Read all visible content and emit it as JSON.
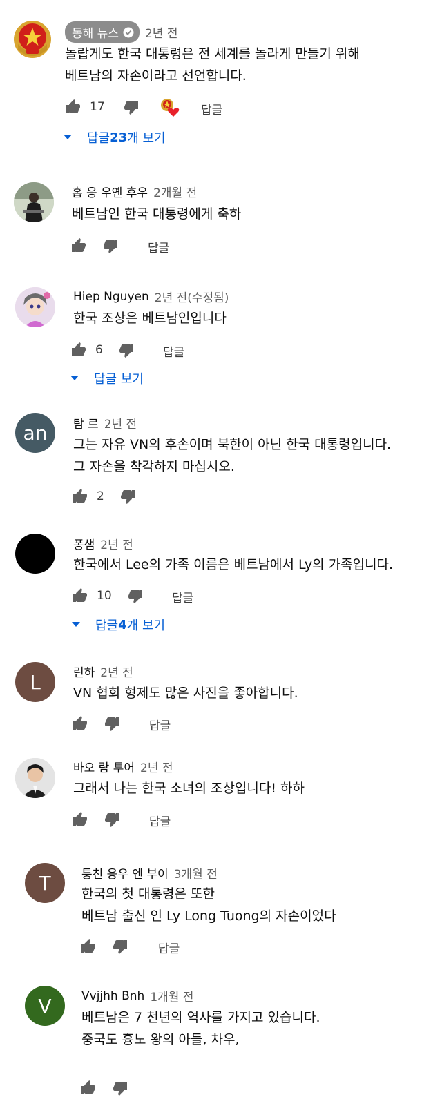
{
  "reply_label": "답글",
  "comments": [
    {
      "author": "동해 뉴스",
      "time": "2년 전",
      "verified": true,
      "lines": [
        "놀랍게도 한국 대통령은 전 세계를 놀라게 만들기 위해",
        "베트남의 자손이라고 선언합니다."
      ],
      "likes": "17",
      "more": {
        "prefix": "답글 ",
        "count": "23",
        "suffix": "개 보기"
      }
    },
    {
      "author": "홉 응 우옌 후우",
      "time": "2개월 전",
      "lines": [
        "베트남인 한국 대통령에게 축하"
      ],
      "likes": ""
    },
    {
      "author": "Hiep Nguyen",
      "time": "2년 전(수정됨)",
      "lines": [
        "한국 조상은 베트남인입니다"
      ],
      "likes": "6",
      "more": {
        "prefix": "답글 보기",
        "count": "",
        "suffix": ""
      }
    },
    {
      "author": "탐 르",
      "time": "2년 전",
      "avatar_letter": "an",
      "avatar_color": "#455a64",
      "lines": [
        "그는 자유 VN의 후손이며 북한이 아닌 한국 대통령입니다.",
        "그 자손을 착각하지 마십시오."
      ],
      "likes": "2"
    },
    {
      "author": "퐁샘",
      "time": "2년 전",
      "avatar_color": "#000000",
      "lines": [
        "한국에서 Lee의 가족 이름은 베트남에서 Ly의 가족입니다."
      ],
      "likes": "10",
      "more": {
        "prefix": "답글 ",
        "count": "4",
        "suffix": "개 보기"
      }
    },
    {
      "author": "린하",
      "time": "2년 전",
      "avatar_letter": "L",
      "avatar_color": "#6d4c41",
      "lines": [
        "VN 협회 형제도 많은 사진을 좋아합니다."
      ],
      "likes": ""
    },
    {
      "author": "바오 람 투어",
      "time": "2년 전",
      "lines": [
        "그래서 나는 한국 소녀의 조상입니다! 하하"
      ],
      "likes": ""
    },
    {
      "author": "퉁친 응우 엔 부이",
      "time": "3개월 전",
      "avatar_letter": "T",
      "avatar_color": "#6d4c41",
      "lines": [
        "한국의 첫 대통령은 또한",
        "베트남 출신 인 Ly Long Tuong의 자손이었다"
      ],
      "likes": ""
    },
    {
      "author": "Vvjjhh Bnh",
      "time": "1개월 전",
      "avatar_letter": "V",
      "avatar_color": "#33691e",
      "lines": [
        "베트남은 7 천년의 역사를 가지고 있습니다.",
        "중국도 흉노 왕의 아들, 차우,"
      ],
      "likes": ""
    }
  ],
  "colors": {
    "link": "#065fd4",
    "text": "#0f0f0f",
    "meta": "#606060",
    "chip": "#8c8c8c"
  },
  "icons": [
    "thumb-up-icon",
    "thumb-down-icon",
    "expand-caret-icon",
    "verified-check-icon",
    "creator-heart-icon"
  ]
}
